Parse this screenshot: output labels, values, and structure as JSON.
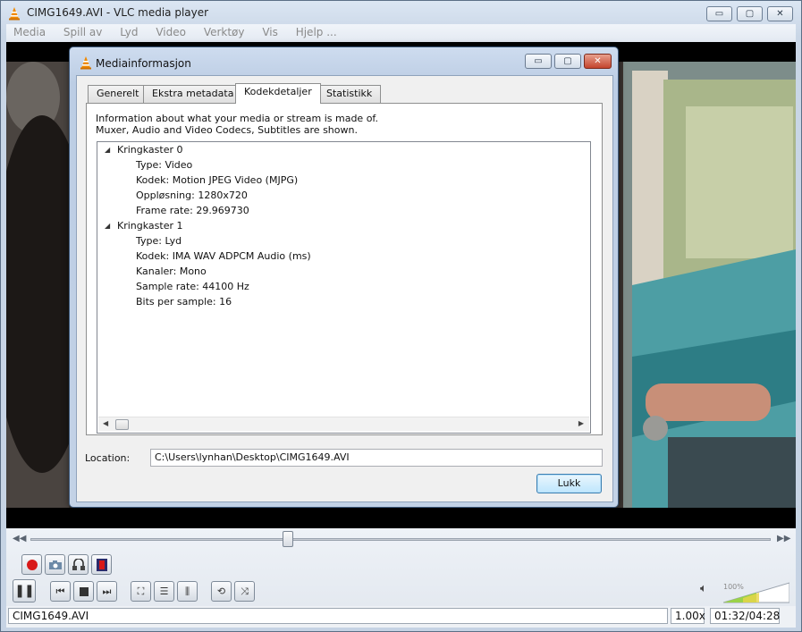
{
  "window": {
    "title": "CIMG1649.AVI - VLC media player",
    "caption_buttons": {
      "minimize": "▭",
      "maximize": "▢",
      "close": "✕"
    }
  },
  "menubar": {
    "items": [
      "Media",
      "Spill av",
      "Lyd",
      "Video",
      "Verktøy",
      "Vis",
      "Hjelp ..."
    ]
  },
  "dialog": {
    "title": "Mediainformasjon",
    "caption_buttons": {
      "minimize": "▭",
      "maximize": "▢",
      "close": "✕"
    },
    "tabs": [
      "Generelt",
      "Ekstra metadata",
      "Kodekdetaljer",
      "Statistikk"
    ],
    "active_tab": "Kodekdetaljer",
    "info_line1": "Information about what your media or stream is made of.",
    "info_line2": "Muxer, Audio and Video Codecs, Subtitles are shown.",
    "streams": [
      {
        "name": "Kringkaster 0",
        "details": [
          "Type: Video",
          "Kodek: Motion JPEG Video (MJPG)",
          "Oppløsning: 1280x720",
          "Frame rate: 29.969730"
        ]
      },
      {
        "name": "Kringkaster 1",
        "details": [
          "Type: Lyd",
          "Kodek: IMA WAV ADPCM Audio (ms)",
          "Kanaler: Mono",
          "Sample rate: 44100 Hz",
          "Bits per sample: 16"
        ]
      }
    ],
    "location_label": "Location:",
    "location_value": "C:\\Users\\lynhan\\Desktop\\CIMG1649.AVI",
    "close_button": "Lukk"
  },
  "player": {
    "seek_position_fraction": 0.348,
    "volume_percent": "100%",
    "volume_level": 1.0
  },
  "statusbar": {
    "filename": "CIMG1649.AVI",
    "speed": "1.00x",
    "time": "01:32/04:28"
  },
  "colors": {
    "accent_orange": "#f08a00",
    "record_red": "#d81818",
    "close_red": "#c4442d"
  }
}
